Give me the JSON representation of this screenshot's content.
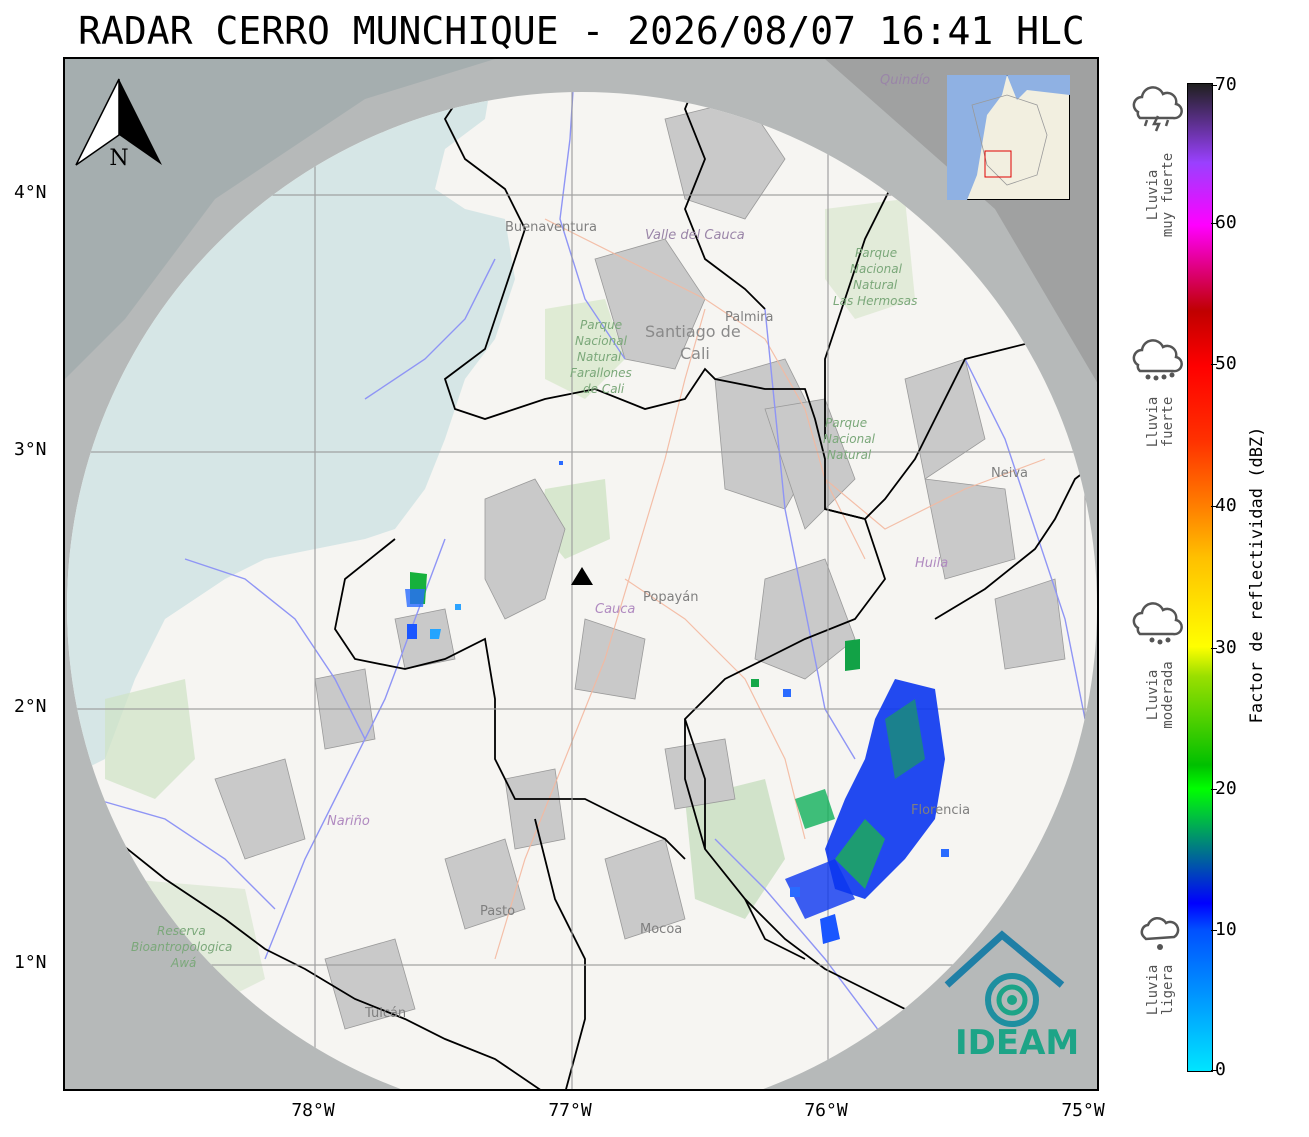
{
  "title": "RADAR CERRO MUNCHIQUE - 2026/08/07 16:41 HLC",
  "map": {
    "north_arrow_letter": "N",
    "lat_ticks": [
      "4°N",
      "3°N",
      "2°N",
      "1°N"
    ],
    "lon_ticks": [
      "78°W",
      "77°W",
      "76°W",
      "75°W"
    ],
    "place_labels": [
      {
        "text": "Buenaventura"
      },
      {
        "text": "Valle del Cauca"
      },
      {
        "text": "Palmira"
      },
      {
        "text": "Santiago de"
      },
      {
        "text": "Cali"
      },
      {
        "text": "Parque"
      },
      {
        "text": "Nacional"
      },
      {
        "text": "Natural"
      },
      {
        "text": "Farallones"
      },
      {
        "text": "de Cali"
      },
      {
        "text": "Parque"
      },
      {
        "text": "Nacional"
      },
      {
        "text": "Natural"
      },
      {
        "text": "Las Hermosas"
      },
      {
        "text": "Parque"
      },
      {
        "text": "Nacional"
      },
      {
        "text": "Natural"
      },
      {
        "text": "Neiva"
      },
      {
        "text": "Huila"
      },
      {
        "text": "Cauca"
      },
      {
        "text": "Popayán"
      },
      {
        "text": "Nariño"
      },
      {
        "text": "Pasto"
      },
      {
        "text": "Mocoa"
      },
      {
        "text": "Reserva"
      },
      {
        "text": "Bioantropologica"
      },
      {
        "text": "Awá"
      },
      {
        "text": "Tulcán"
      },
      {
        "text": "Florencia"
      },
      {
        "text": "Quindío"
      }
    ]
  },
  "colorbar": {
    "label": "Factor de reflectividad (dBZ)",
    "min": 0,
    "max": 70,
    "ticks": [
      "70",
      "60",
      "50",
      "40",
      "30",
      "20",
      "10",
      "0"
    ],
    "colors": {
      "low": "#00e5ff",
      "blue": "#0000ff",
      "green": "#00ff00",
      "yellow": "#ffff00",
      "red": "#ff0000",
      "magenta": "#ff00ff",
      "dark": "#202020"
    }
  },
  "rain_legend": [
    {
      "icon": "thunderstorm-cloud-icon",
      "line1": "Lluvia",
      "line2": "muy fuerte"
    },
    {
      "icon": "heavy-rain-cloud-icon",
      "line1": "Lluvia",
      "line2": "fuerte"
    },
    {
      "icon": "moderate-rain-cloud-icon",
      "line1": "Lluvia",
      "line2": "moderada"
    },
    {
      "icon": "light-rain-cloud-icon",
      "line1": "Lluvia",
      "line2": "ligera"
    }
  ],
  "logo": {
    "text": "IDEAM",
    "color": "#1da487"
  }
}
